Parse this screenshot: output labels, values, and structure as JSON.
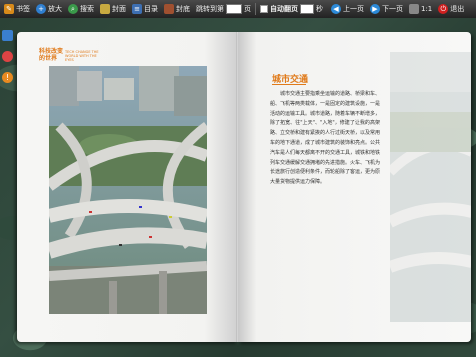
{
  "toolbar": {
    "bookmark_label": "书签",
    "zoom_label": "放大",
    "search_label": "搜索",
    "cover_label": "封面",
    "toc_label": "目录",
    "back_cover_label": "封底",
    "jump_prefix": "跳转到第",
    "jump_suffix": "页",
    "auto_flip_label": "自动翻页",
    "seconds_label": "秒",
    "prev_label": "上一页",
    "next_label": "下一页",
    "ratio_label": "1:1",
    "exit_label": "退出"
  },
  "icons": {
    "bookmark": "bookmark-icon",
    "zoom": "zoom-in-icon",
    "search": "search-icon",
    "cover": "cover-icon",
    "toc": "toc-icon",
    "back_cover": "back-cover-icon",
    "prev": "prev-arrow-icon",
    "next": "next-arrow-icon",
    "ratio": "actual-size-icon",
    "exit": "exit-icon"
  },
  "side_icons": [
    "book-icon",
    "settings-icon",
    "info-icon"
  ],
  "left_page": {
    "logo_zh": "科技改变的世界",
    "logo_en": "TECH CHANGE THE WORLD WITH THE EYES"
  },
  "right_page": {
    "heading": "城市交通",
    "body": "城市交通主要指乘坐运输的道路、桥梁和车、船、飞机等两类载体，一是固定的建筑设施，一是活动的运输工具。城市道路，随着车辆不断增多，除了拓宽、往\"上天\"、\"入地\"，修建了让我的高架路、立交桥和建有紧挨的人行过街天桥，以及常用车的地下通道，成了城市建筑的装饰和亮点。公共汽车是人们每天都离不开的交通工具，城铁和地铁列车交通缓解交通拥堵的先进措施。火车、飞机为长途旅行创造便利条件，而轮船除了客运，更为原大量货物提供运力保障。"
  },
  "colors": {
    "accent": "#e07a1a",
    "toolbar_bg": "#2e2e2e",
    "page_bg": "#f6f6f4"
  }
}
